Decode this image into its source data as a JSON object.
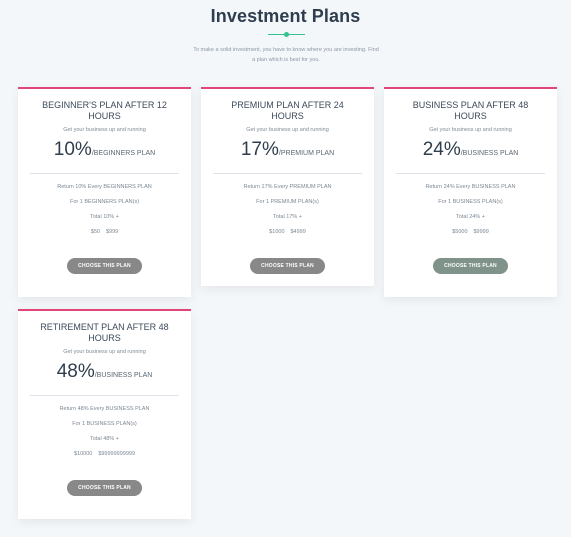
{
  "header": {
    "title": "Investment Plans",
    "subtitle_line1": "To make a solid investment, you have to know where you are investing. Find",
    "subtitle_line2": "a plan which is best for you."
  },
  "plans": [
    {
      "title": "BEGINNER'S PLAN AFTER 12 HOURS",
      "tagline": "Get your business up and running",
      "rate": "10",
      "rate_unit": "%",
      "rate_label": "/BEGINNERS PLAN",
      "return_text": "Return 10% Every BEGINNERS PLAN",
      "count_text": "For 1 BEGINNERS PLAN(s)",
      "total_text": "Total 10% +",
      "min": "$50",
      "max": "$999",
      "button": "CHOOSE THIS PLAN"
    },
    {
      "title": "PREMIUM PLAN AFTER 24 HOURS",
      "tagline": "Get your business up and running",
      "rate": "17",
      "rate_unit": "%",
      "rate_label": "/PREMIUM PLAN",
      "return_text": "Return 17% Every PREMIUM PLAN",
      "count_text": "For 1 PREMIUM PLAN(s)",
      "total_text": "Total 17% +",
      "min": "$1000",
      "max": "$4999",
      "button": "CHOOSE THIS PLAN"
    },
    {
      "title": "BUSINESS PLAN AFTER 48 HOURS",
      "tagline": "Get your business up and running",
      "rate": "24",
      "rate_unit": "%",
      "rate_label": "/BUSINESS PLAN",
      "return_text": "Return 24% Every BUSINESS PLAN",
      "count_text": "For 1 BUSINESS PLAN(s)",
      "total_text": "Total 24% +",
      "min": "$5000",
      "max": "$9999",
      "button": "CHOOSE THIS PLAN"
    },
    {
      "title": "RETIREMENT PLAN AFTER 48 HOURS",
      "tagline": "Get your business up and running",
      "rate": "48",
      "rate_unit": "%",
      "rate_label": "/BUSINESS PLAN",
      "return_text": "Return 48% Every BUSINESS PLAN",
      "count_text": "For 1 BUSINESS PLAN(s)",
      "total_text": "Total 48% +",
      "min": "$10000",
      "max": "$99999999999",
      "button": "CHOOSE THIS PLAN"
    }
  ],
  "colors": {
    "accent_border": "#e2457a",
    "divider": "#34c38f",
    "button_gray": "#888888",
    "button_green": "#7f938b"
  }
}
